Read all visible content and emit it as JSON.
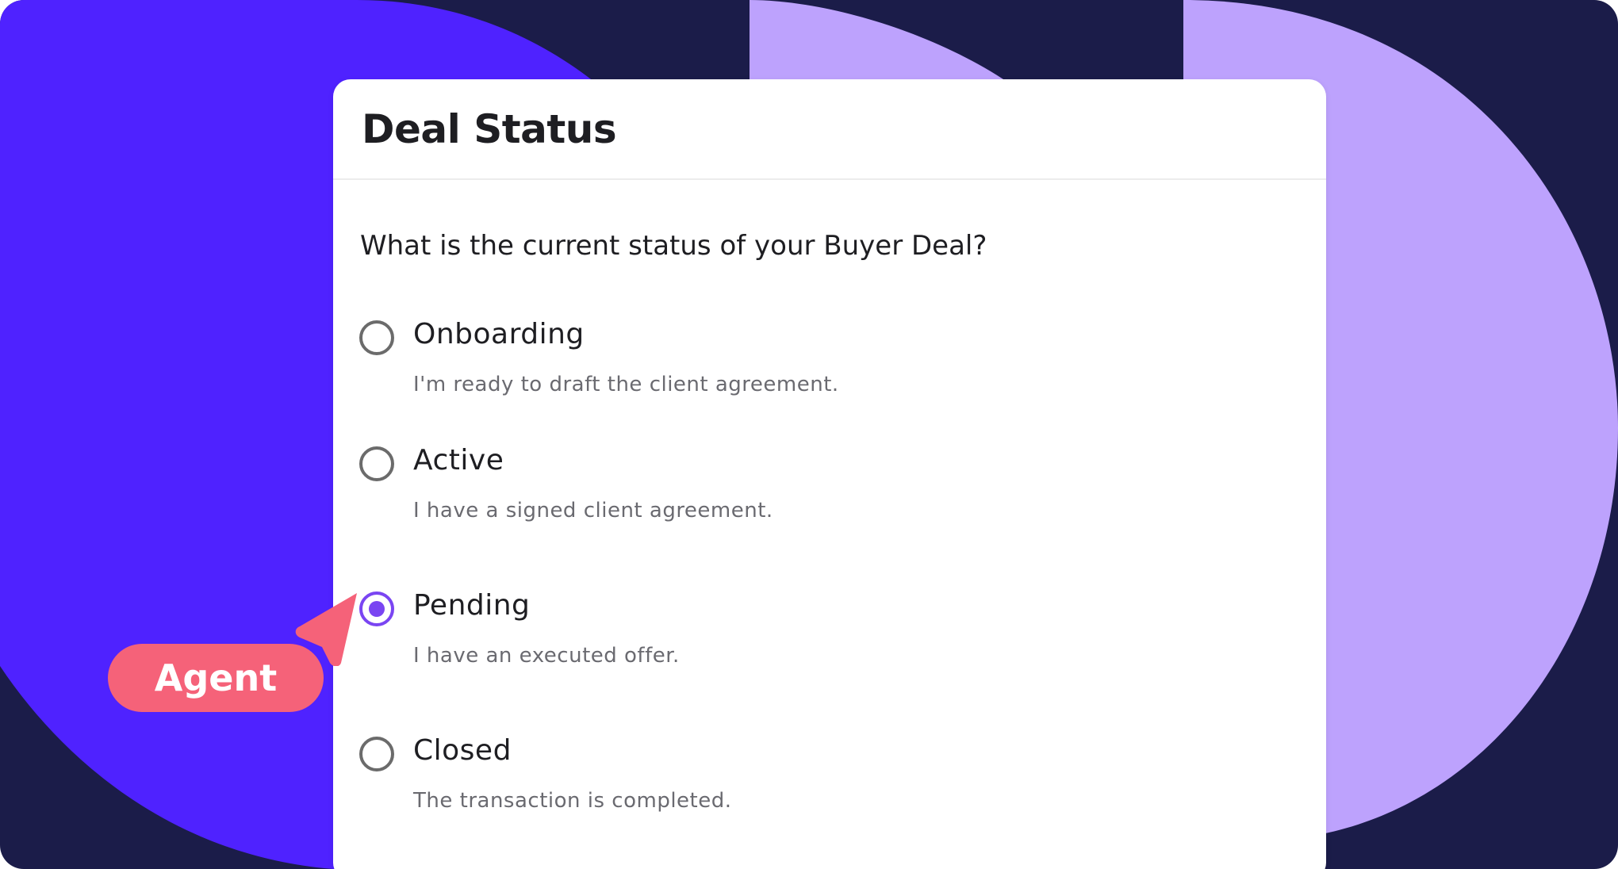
{
  "colors": {
    "background": "#1b1c49",
    "blue_shape": "#4f22ff",
    "lavender_shape": "#bda2fd",
    "card": "#ffffff",
    "radio_selected": "#7a45f2",
    "radio_default": "#6b6b6b",
    "agent_pill": "#f56279"
  },
  "card": {
    "title": "Deal Status",
    "question": "What is the current status of your Buyer Deal?",
    "selected_option": "Pending",
    "options": [
      {
        "label": "Onboarding",
        "description": "I'm ready to draft the client agreement.",
        "checked": false
      },
      {
        "label": "Active",
        "description": "I have a signed client agreement.",
        "checked": false
      },
      {
        "label": "Pending",
        "description": "I have an executed offer.",
        "checked": true
      },
      {
        "label": "Closed",
        "description": "The transaction is completed.",
        "checked": false
      }
    ]
  },
  "cursor_tag": {
    "label": "Agent",
    "icon": "pointer-arrow-icon"
  }
}
